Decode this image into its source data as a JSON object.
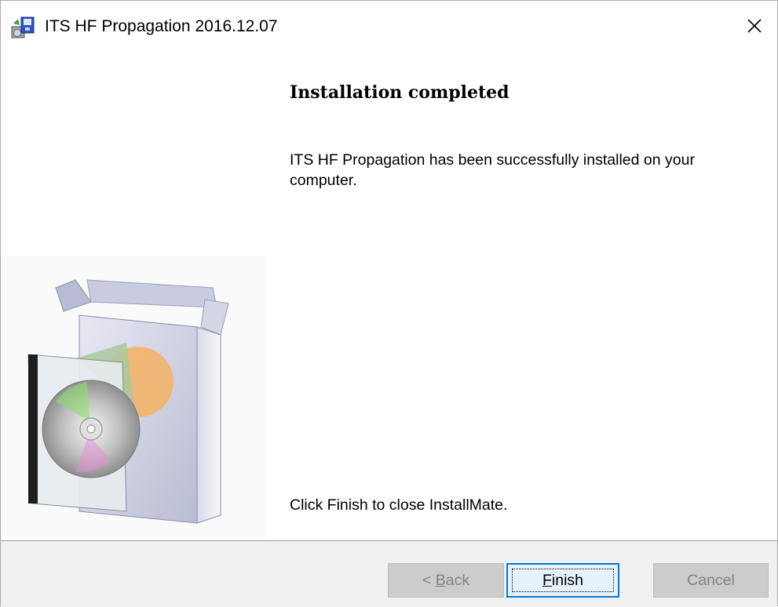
{
  "window": {
    "title": "ITS HF Propagation 2016.12.07",
    "icon": "installer-icon"
  },
  "content": {
    "heading": "Installation completed",
    "message": "ITS HF Propagation has been successfully installed on your computer.",
    "footer": "Click Finish to close InstallMate."
  },
  "buttons": {
    "back": {
      "prefix": "< ",
      "mnemonic": "B",
      "rest": "ack",
      "enabled": false
    },
    "finish": {
      "prefix": "",
      "mnemonic": "F",
      "rest": "inish",
      "enabled": true,
      "focused": true
    },
    "cancel": {
      "label": "Cancel",
      "enabled": false
    }
  },
  "colors": {
    "focus_border": "#0078d7",
    "button_bar": "#f0f0f0",
    "disabled_text": "#838383"
  }
}
